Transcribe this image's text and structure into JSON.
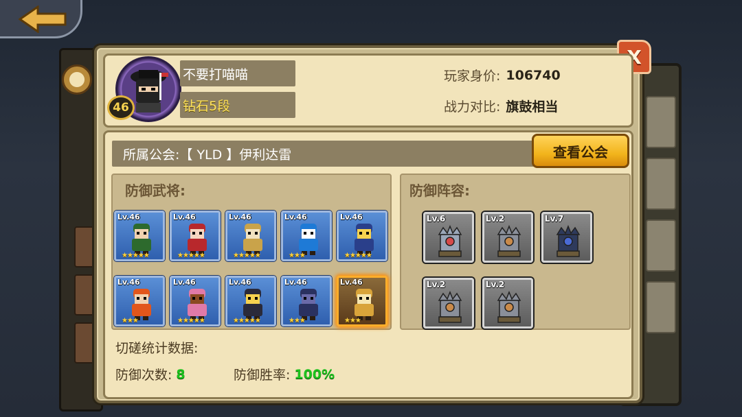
{
  "player": {
    "name": "不要打喵喵",
    "level": "46",
    "rank": "钻石5段",
    "worth_label": "玩家身价:",
    "worth_value": "106740",
    "power_label": "战力对比:",
    "power_value": "旗鼓相当"
  },
  "guild": {
    "text": "所属公会:【 YLD 】伊利达雷",
    "button_label": "查看公会"
  },
  "close_label": "X",
  "defense_heroes": {
    "title": "防御武将:",
    "items": [
      {
        "lv": "Lv.46",
        "stars": "★★★★★",
        "icon": "hero-green-warrior"
      },
      {
        "lv": "Lv.46",
        "stars": "★★★★★",
        "icon": "hero-red-lady"
      },
      {
        "lv": "Lv.46",
        "stars": "★★★★★",
        "icon": "hero-gold-knight"
      },
      {
        "lv": "Lv.46",
        "stars": "★★★",
        "icon": "hero-blue-cat"
      },
      {
        "lv": "Lv.46",
        "stars": "★★★★★",
        "icon": "hero-mage"
      },
      {
        "lv": "Lv.46",
        "stars": "★★★",
        "icon": "hero-fire-pirate"
      },
      {
        "lv": "Lv.46",
        "stars": "★★★★★",
        "icon": "hero-pink-reindeer"
      },
      {
        "lv": "Lv.46",
        "stars": "★★★★★",
        "icon": "hero-blonde-suit"
      },
      {
        "lv": "Lv.46",
        "stars": "★★★",
        "icon": "hero-dark-beast"
      },
      {
        "lv": "Lv.46",
        "stars": "★★★",
        "icon": "hero-golden-swordsman"
      }
    ]
  },
  "defense_towers": {
    "title": "防御阵容:",
    "items": [
      {
        "lv": "Lv.6",
        "icon": "tower-gem"
      },
      {
        "lv": "Lv.2",
        "icon": "tower-cannon"
      },
      {
        "lv": "Lv.7",
        "icon": "tower-dark"
      },
      {
        "lv": "Lv.2",
        "icon": "tower-cannon"
      },
      {
        "lv": "Lv.2",
        "icon": "tower-cannon"
      }
    ]
  },
  "stats": {
    "title": "切磋统计数据:",
    "defense_count_label": "防御次数:",
    "defense_count_value": "8",
    "win_rate_label": "防御胜率:",
    "win_rate_value": "100%"
  },
  "colors": {
    "accent_gold": "#f2b41c",
    "win_green": "#1ec21e",
    "hero_card_blue": "#2f5fae"
  }
}
